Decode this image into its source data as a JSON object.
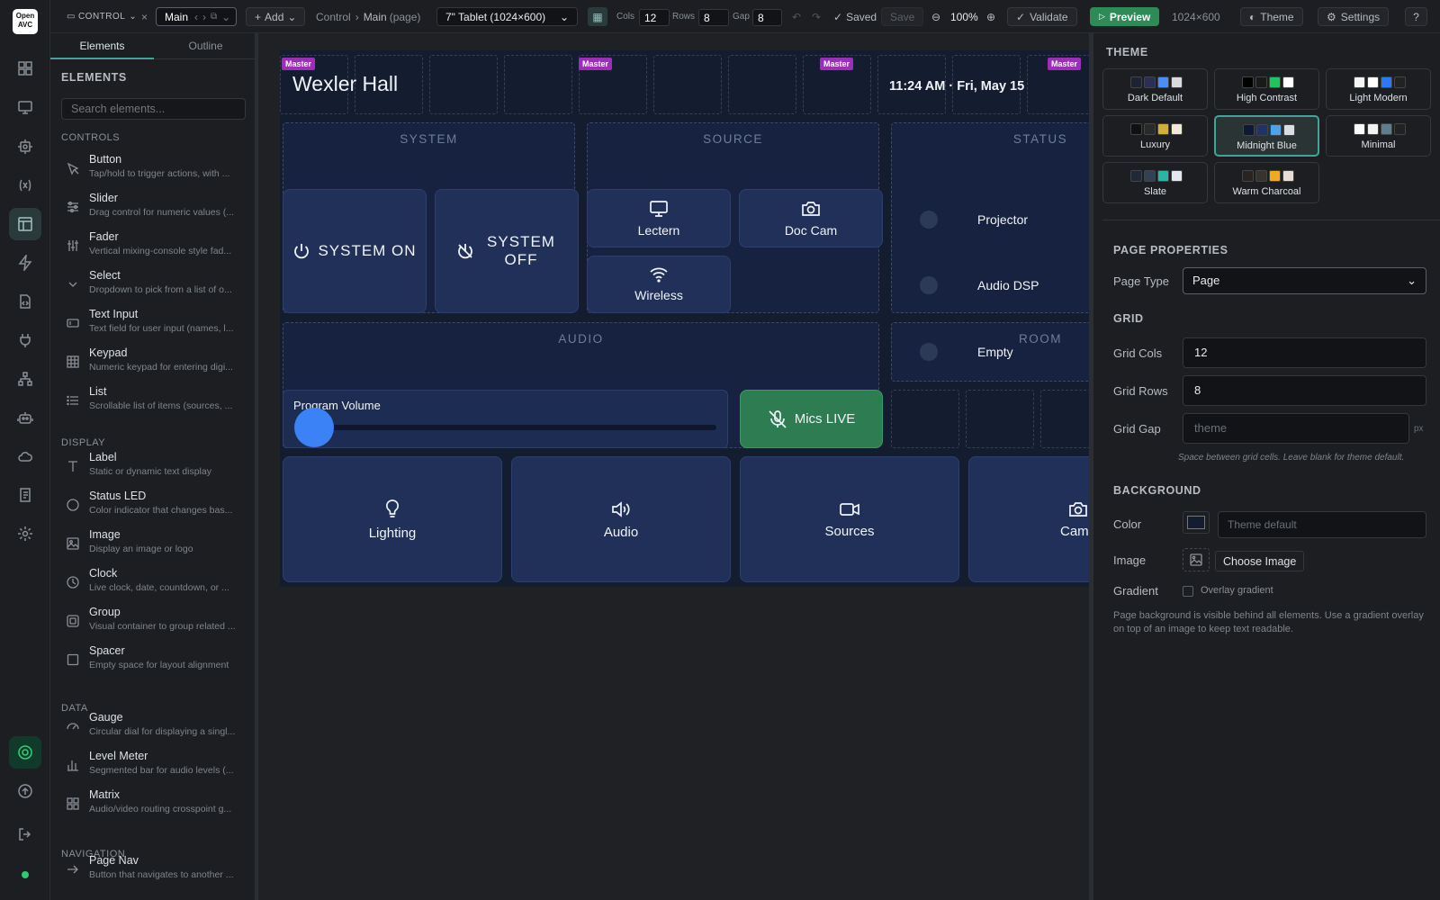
{
  "logo": {
    "text": "Open AVC"
  },
  "topbar": {
    "project": "CONTROL",
    "page_tab": "Main",
    "add": "Add",
    "breadcrumb_root": "Control",
    "breadcrumb_sep": "›",
    "breadcrumb_page": "Main",
    "breadcrumb_kind": "(page)",
    "device": "7\" Tablet (1024×600)",
    "cols_label": "Cols",
    "cols": "12",
    "rows_label": "Rows",
    "rows": "8",
    "gap_label": "Gap",
    "gap": "8",
    "saved": "Saved",
    "save": "Save",
    "zoom": "100%",
    "validate": "Validate",
    "preview": "Preview",
    "resolution": "1024×600",
    "theme": "Theme",
    "settings": "Settings",
    "help": "?"
  },
  "panel": {
    "tab_elements": "Elements",
    "tab_outline": "Outline",
    "title": "ELEMENTS",
    "search_placeholder": "Search elements...",
    "sections": {
      "controls": "CONTROLS",
      "display": "DISPLAY",
      "data": "DATA",
      "navigation": "NAVIGATION"
    },
    "items": [
      {
        "name": "Button",
        "desc": "Tap/hold to trigger actions, with ...",
        "icon": "pointer-icon"
      },
      {
        "name": "Slider",
        "desc": "Drag control for numeric values (...",
        "icon": "sliders-icon"
      },
      {
        "name": "Fader",
        "desc": "Vertical mixing-console style fad...",
        "icon": "fader-icon"
      },
      {
        "name": "Select",
        "desc": "Dropdown to pick from a list of o...",
        "icon": "chevron-down-icon"
      },
      {
        "name": "Text Input",
        "desc": "Text field for user input (names, l...",
        "icon": "text-input-icon"
      },
      {
        "name": "Keypad",
        "desc": "Numeric keypad for entering digi...",
        "icon": "keypad-icon"
      },
      {
        "name": "List",
        "desc": "Scrollable list of items (sources, ...",
        "icon": "list-icon"
      },
      {
        "name": "Label",
        "desc": "Static or dynamic text display",
        "icon": "text-icon"
      },
      {
        "name": "Status LED",
        "desc": "Color indicator that changes bas...",
        "icon": "circle-icon"
      },
      {
        "name": "Image",
        "desc": "Display an image or logo",
        "icon": "image-icon"
      },
      {
        "name": "Clock",
        "desc": "Live clock, date, countdown, or ...",
        "icon": "clock-icon"
      },
      {
        "name": "Group",
        "desc": "Visual container to group related ...",
        "icon": "group-icon"
      },
      {
        "name": "Spacer",
        "desc": "Empty space for layout alignment",
        "icon": "square-icon"
      },
      {
        "name": "Gauge",
        "desc": "Circular dial for displaying a singl...",
        "icon": "gauge-icon"
      },
      {
        "name": "Level Meter",
        "desc": "Segmented bar for audio levels (...",
        "icon": "bar-chart-icon"
      },
      {
        "name": "Matrix",
        "desc": "Audio/video routing crosspoint g...",
        "icon": "grid-icon"
      },
      {
        "name": "Page Nav",
        "desc": "Button that navigates to another ...",
        "icon": "arrow-right-icon"
      }
    ]
  },
  "canvas": {
    "master": "Master",
    "title": "Wexler Hall",
    "clock": "11:24 AM · Fri, May 15",
    "groups": {
      "system": "SYSTEM",
      "source": "SOURCE",
      "status": "STATUS",
      "audio": "AUDIO",
      "room": "ROOM"
    },
    "system_on": "SYSTEM ON",
    "system_off": "SYSTEM OFF",
    "sources": [
      "Lectern",
      "Doc Cam",
      "Wireless"
    ],
    "status_items": [
      "Projector",
      "Audio DSP",
      "Empty"
    ],
    "volume_label": "Program Volume",
    "volume_level": 0.0,
    "mics": "Mics LIVE",
    "nav": [
      "Lighting",
      "Audio",
      "Sources",
      "Came"
    ]
  },
  "right": {
    "theme_title": "THEME",
    "themes": [
      {
        "name": "Dark Default",
        "colors": [
          "#1e2235",
          "#2c2f55",
          "#4b8df8",
          "#d9dbe0"
        ]
      },
      {
        "name": "High Contrast",
        "colors": [
          "#000000",
          "#1a1a1a",
          "#21c55d",
          "#ffffff"
        ]
      },
      {
        "name": "Light Modern",
        "colors": [
          "#f5f5f5",
          "#ffffff",
          "#2979ff",
          "#222222"
        ]
      },
      {
        "name": "Luxury",
        "colors": [
          "#111111",
          "#2a2a2a",
          "#d4af37",
          "#f1ead8"
        ]
      },
      {
        "name": "Midnight Blue",
        "colors": [
          "#0d1a36",
          "#1f3367",
          "#4aa3f0",
          "#d9dde6"
        ]
      },
      {
        "name": "Minimal",
        "colors": [
          "#ffffff",
          "#f2f2f2",
          "#5f7e8c",
          "#222222"
        ]
      },
      {
        "name": "Slate",
        "colors": [
          "#1f2937",
          "#334155",
          "#2ab3a6",
          "#e2e8f0"
        ]
      },
      {
        "name": "Warm Charcoal",
        "colors": [
          "#2a2421",
          "#3a322d",
          "#f5a623",
          "#e7ddd5"
        ]
      }
    ],
    "selected_theme": "Midnight Blue",
    "page_props": "PAGE PROPERTIES",
    "page_type_label": "Page Type",
    "page_type": "Page",
    "grid": "GRID",
    "grid_cols_label": "Grid Cols",
    "grid_cols": "12",
    "grid_rows_label": "Grid Rows",
    "grid_rows": "8",
    "grid_gap_label": "Grid Gap",
    "grid_gap_placeholder": "theme",
    "px": "px",
    "gap_hint": "Space between grid cells. Leave blank for theme default.",
    "background": "BACKGROUND",
    "color_label": "Color",
    "color_placeholder": "Theme default",
    "image_label": "Image",
    "choose_image": "Choose Image",
    "gradient_label": "Gradient",
    "overlay": "Overlay gradient",
    "bg_hint": "Page background is visible behind all elements. Use a gradient overlay on top of an image to keep text readable."
  },
  "colors": {
    "accent": "#3fa59a",
    "master": "#9b2fb5",
    "preview": "#2e8b57",
    "mics": "#2e7d52",
    "slider": "#3b82f6"
  }
}
